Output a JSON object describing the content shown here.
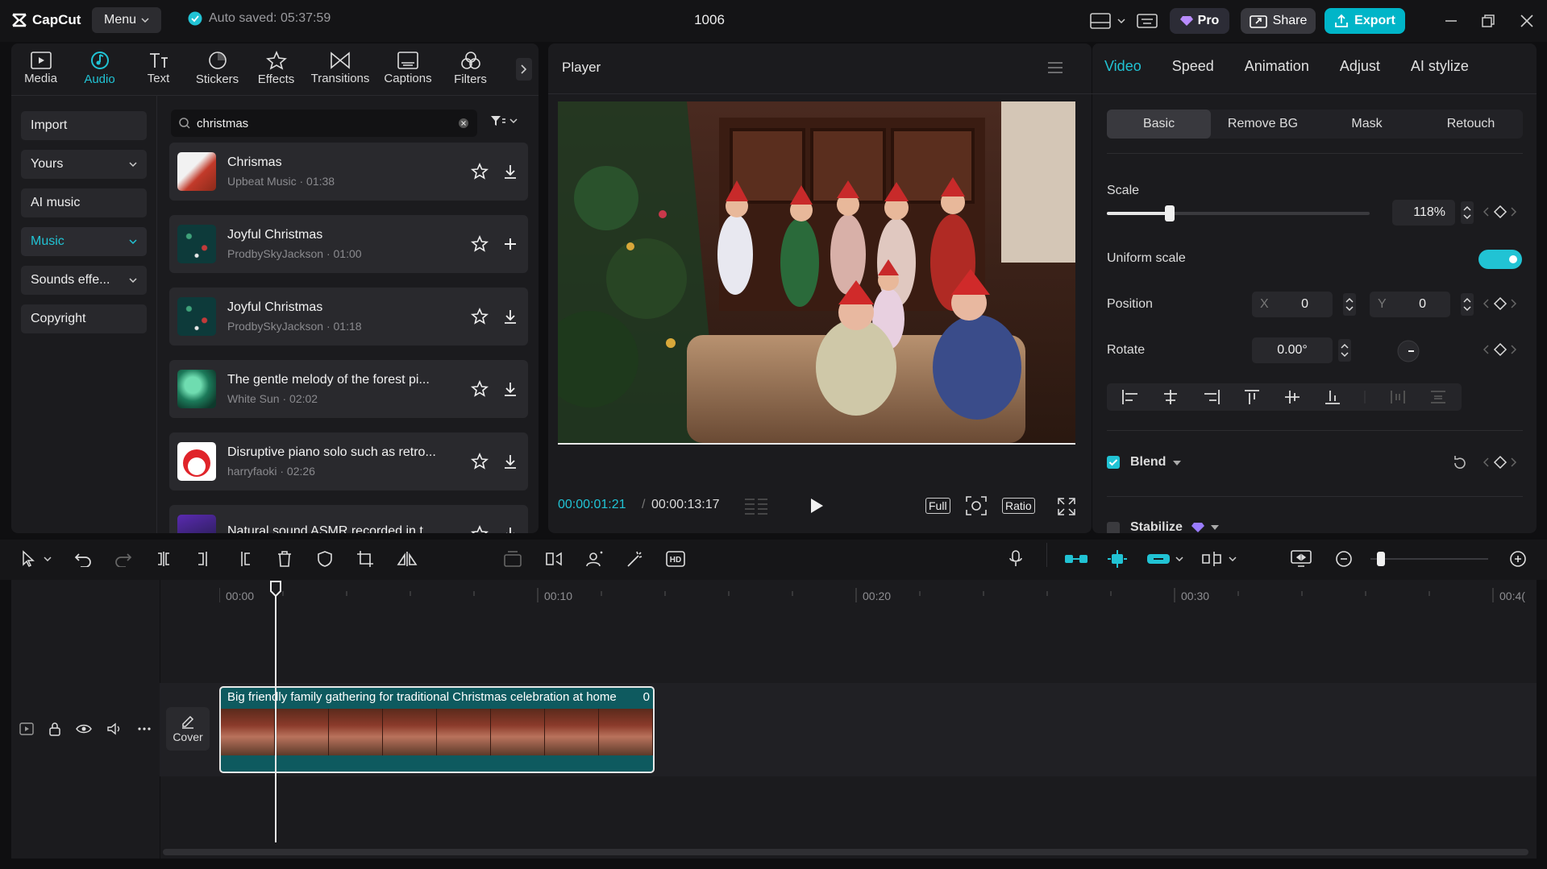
{
  "app": {
    "logo_text": "CapCut",
    "menu_label": "Menu",
    "autosave_text": "Auto saved: 05:37:59",
    "project_title": "1006",
    "pro_label": "Pro",
    "share_label": "Share",
    "export_label": "Export",
    "accent_color": "#21c3d4"
  },
  "tool_tabs": [
    {
      "label": "Media",
      "icon": "media-icon"
    },
    {
      "label": "Audio",
      "icon": "audio-icon",
      "active": true
    },
    {
      "label": "Text",
      "icon": "text-icon"
    },
    {
      "label": "Stickers",
      "icon": "stickers-icon"
    },
    {
      "label": "Effects",
      "icon": "effects-icon"
    },
    {
      "label": "Transitions",
      "icon": "transitions-icon"
    },
    {
      "label": "Captions",
      "icon": "captions-icon"
    },
    {
      "label": "Filters",
      "icon": "filters-icon"
    }
  ],
  "sidebar": {
    "items": [
      {
        "label": "Import"
      },
      {
        "label": "Yours",
        "dropdown": true
      },
      {
        "label": "AI music"
      },
      {
        "label": "Music",
        "dropdown": true,
        "active": true
      },
      {
        "label": "Sounds effe...",
        "dropdown": true
      },
      {
        "label": "Copyright"
      }
    ]
  },
  "search": {
    "value": "christmas"
  },
  "tracks": [
    {
      "title": "Chrismas",
      "meta": "Upbeat Music · 01:38",
      "action": "download"
    },
    {
      "title": "Joyful Christmas",
      "meta": "ProdbySkyJackson · 01:00",
      "action": "add"
    },
    {
      "title": "Joyful Christmas",
      "meta": "ProdbySkyJackson · 01:18",
      "action": "download"
    },
    {
      "title": "The gentle melody of the forest pi...",
      "meta": "White Sun · 02:02",
      "action": "download"
    },
    {
      "title": "Disruptive piano solo such as retro...",
      "meta": "harryfaoki · 02:26",
      "action": "download"
    },
    {
      "title": "Natural sound ASMR recorded in t...",
      "meta": "",
      "action": "download"
    }
  ],
  "player": {
    "title": "Player",
    "current_time": "00:00:01:21",
    "separator": "/",
    "total_time": "00:00:13:17",
    "full_label": "Full",
    "ratio_label": "Ratio"
  },
  "right_panel": {
    "tabs": [
      "Video",
      "Speed",
      "Animation",
      "Adjust",
      "AI stylize"
    ],
    "sub_tabs": [
      "Basic",
      "Remove BG",
      "Mask",
      "Retouch"
    ],
    "scale_label": "Scale",
    "scale_value": "118%",
    "scale_fraction": 0.24,
    "uniform_scale_label": "Uniform scale",
    "uniform_scale_on": true,
    "position_label": "Position",
    "x_label": "X",
    "x_value": "0",
    "y_label": "Y",
    "y_value": "0",
    "rotate_label": "Rotate",
    "rotate_value": "0.00°",
    "blend_label": "Blend",
    "blend_checked": true,
    "stabilize_label": "Stabilize"
  },
  "timeline": {
    "ruler": [
      "00:00",
      "00:10",
      "00:20",
      "00:30",
      "00:4("
    ],
    "cover_label": "Cover",
    "clip_title": "Big friendly family gathering for traditional Christmas celebration at home",
    "clip_badge": "0"
  }
}
